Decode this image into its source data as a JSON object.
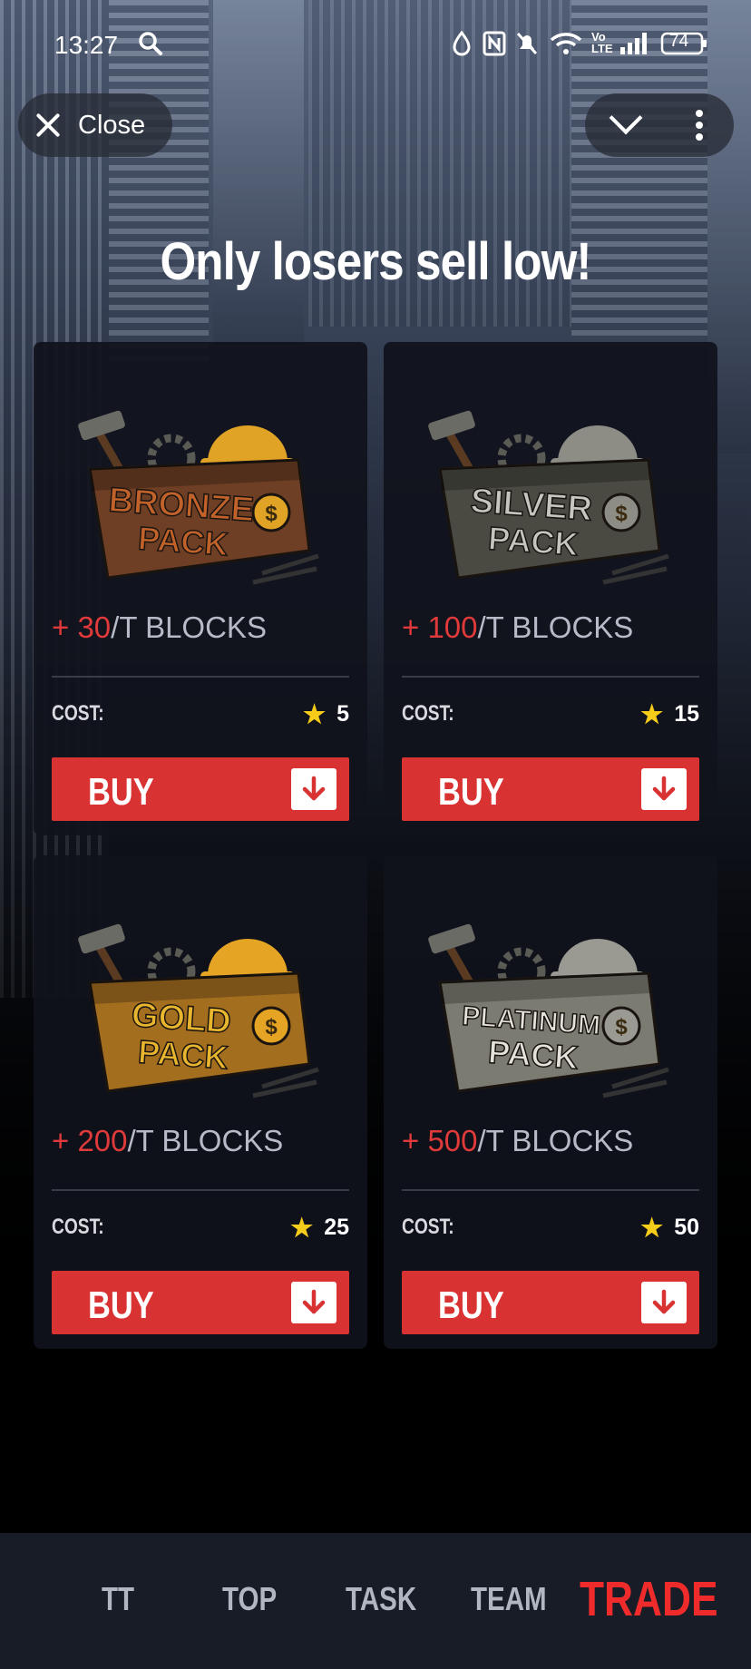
{
  "status_bar": {
    "time": "13:27",
    "battery": "74",
    "icons": [
      "search-icon",
      "data-saver-icon",
      "nfc-icon",
      "mute-icon",
      "wifi-icon",
      "volte-icon",
      "signal-icon",
      "battery-icon"
    ]
  },
  "header": {
    "close_label": "Close",
    "menu_icons": [
      "chevron-down-icon",
      "more-vertical-icon"
    ]
  },
  "headline": "Only losers sell low!",
  "packs": [
    {
      "name": "BRONZE",
      "name2": "PACK",
      "plus": "+",
      "amount": "30",
      "unit": "/T BLOCKS",
      "cost_label": "COST:",
      "cost": "5",
      "buy_label": "BUY",
      "color": "#c0622a",
      "box": "#6e3f24",
      "helmet": "#e0a326"
    },
    {
      "name": "SILVER",
      "name2": "PACK",
      "plus": "+",
      "amount": "100",
      "unit": "/T BLOCKS",
      "cost_label": "COST:",
      "cost": "15",
      "buy_label": "BUY",
      "color": "#c6c6c0",
      "box": "#4a4a42",
      "helmet": "#8d8d86"
    },
    {
      "name": "GOLD",
      "name2": "PACK",
      "plus": "+",
      "amount": "200",
      "unit": "/T BLOCKS",
      "cost_label": "COST:",
      "cost": "25",
      "buy_label": "BUY",
      "color": "#e8b52e",
      "box": "#a46e1f",
      "helmet": "#e5a423"
    },
    {
      "name": "PLATINUM",
      "name2": "PACK",
      "plus": "+",
      "amount": "500",
      "unit": "/T BLOCKS",
      "cost_label": "COST:",
      "cost": "50",
      "buy_label": "BUY",
      "color": "#e4e2da",
      "box": "#7c7b72",
      "helmet": "#9a9a92"
    }
  ],
  "bottom_nav": [
    {
      "label": "TT",
      "active": false
    },
    {
      "label": "TOP",
      "active": false
    },
    {
      "label": "TASK",
      "active": false
    },
    {
      "label": "TEAM",
      "active": false
    },
    {
      "label": "TRADE",
      "active": true
    }
  ],
  "colors": {
    "accent": "#d93232",
    "star": "#f5cc1a",
    "active_nav": "#ef2b2b"
  }
}
